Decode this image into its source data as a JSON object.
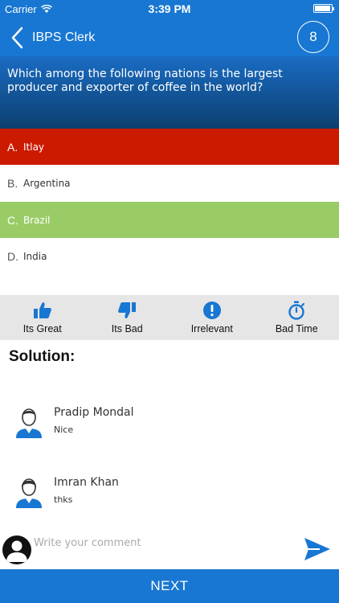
{
  "status_bar": {
    "carrier": "Carrier",
    "time": "3:39 PM"
  },
  "nav": {
    "back_title": "IBPS Clerk",
    "question_number": "8"
  },
  "question": {
    "text": "Which among the following nations is the largest producer and exporter of coffee in the world?"
  },
  "options": [
    {
      "letter": "A.",
      "text": "Itlay",
      "state": "wrong"
    },
    {
      "letter": "B.",
      "text": "Argentina",
      "state": "neutral"
    },
    {
      "letter": "C.",
      "text": "Brazil",
      "state": "correct"
    },
    {
      "letter": "D.",
      "text": "India",
      "state": "neutral"
    }
  ],
  "feedback": [
    {
      "label": "Its Great",
      "icon": "thumbs-up-icon"
    },
    {
      "label": "Its Bad",
      "icon": "thumbs-down-icon"
    },
    {
      "label": "Irrelevant",
      "icon": "exclamation-circle-icon"
    },
    {
      "label": "Bad Time",
      "icon": "stopwatch-icon"
    }
  ],
  "solution": {
    "title": "Solution:"
  },
  "comments": [
    {
      "name": "Pradip Mondal",
      "message": "Nice"
    },
    {
      "name": "Imran Khan",
      "message": "thks"
    }
  ],
  "composer": {
    "placeholder": "Write your comment"
  },
  "footer": {
    "next_label": "NEXT"
  },
  "colors": {
    "primary": "#1877d2",
    "wrong": "#cc1a00",
    "correct": "#99cc66",
    "feedback_bg": "#e6e6e6"
  }
}
